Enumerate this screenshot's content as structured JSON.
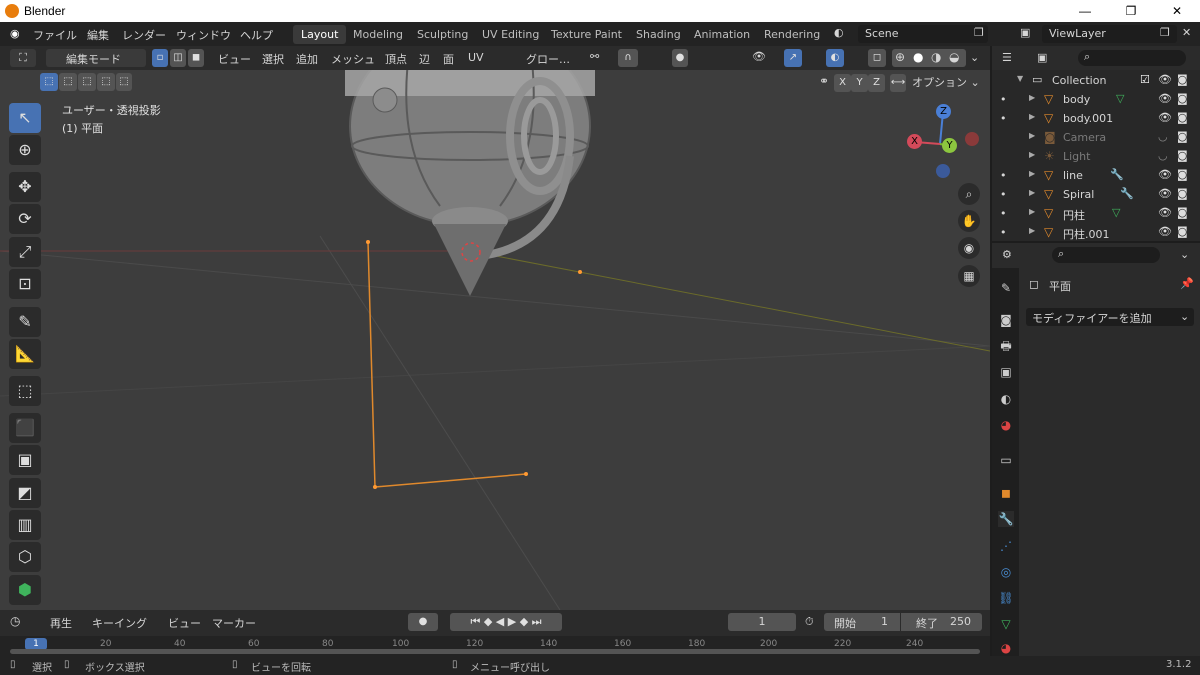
{
  "window": {
    "title": "Blender",
    "min": "—",
    "max": "❐",
    "close": "✕"
  },
  "menu": [
    "ファイル",
    "編集",
    "レンダー",
    "ウィンドウ",
    "ヘルプ"
  ],
  "workspaces": [
    "Layout",
    "Modeling",
    "Sculpting",
    "UV Editing",
    "Texture Paint",
    "Shading",
    "Animation",
    "Rendering"
  ],
  "scene": "Scene",
  "viewlayer": "ViewLayer",
  "viewport": {
    "mode": "編集モード",
    "menus": [
      "ビュー",
      "選択",
      "追加",
      "メッシュ",
      "頂点",
      "辺",
      "面",
      "UV"
    ],
    "transform": "グロー…",
    "view_name": "ユーザー・透視投影",
    "object_name": "(1) 平面",
    "options": "オプション",
    "axes": [
      "X",
      "Y",
      "Z"
    ],
    "gizmo": {
      "x": "X",
      "y": "Y",
      "z": "Z"
    }
  },
  "outliner": {
    "collection": "Collection",
    "items": [
      {
        "name": "body",
        "dim": false
      },
      {
        "name": "body.001",
        "dim": false
      },
      {
        "name": "Camera",
        "dim": true
      },
      {
        "name": "Light",
        "dim": true
      },
      {
        "name": "line",
        "dim": false
      },
      {
        "name": "Spiral",
        "dim": false
      },
      {
        "name": "円柱",
        "dim": false
      },
      {
        "name": "円柱.001",
        "dim": false
      }
    ]
  },
  "properties": {
    "object": "平面",
    "add_modifier": "モディファイアーを追加"
  },
  "timeline": {
    "playback": "再生",
    "keying": "キーイング",
    "view": "ビュー",
    "marker": "マーカー",
    "current_frame": "1",
    "start_label": "開始",
    "start": "1",
    "end_label": "終了",
    "end": "250",
    "ticks": [
      "1",
      "20",
      "40",
      "60",
      "80",
      "100",
      "120",
      "140",
      "160",
      "180",
      "200",
      "220",
      "240"
    ]
  },
  "status": {
    "select": "選択",
    "box_select": "ボックス選択",
    "rotate": "ビューを回転",
    "menu": "メニュー呼び出し",
    "version": "3.1.2"
  },
  "colors": {
    "accent": "#4772b3",
    "orange": "#e0892c",
    "green": "#3fb35c"
  }
}
